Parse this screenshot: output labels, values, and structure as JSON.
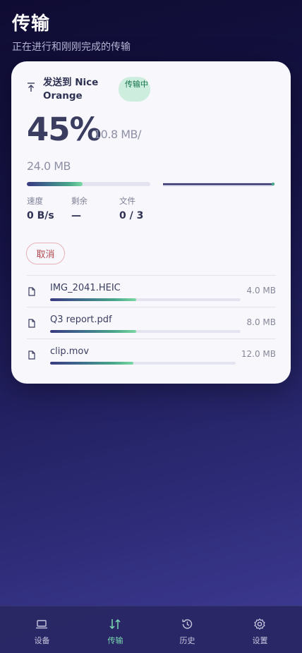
{
  "header": {
    "title": "传输",
    "subtitle": "正在进行和刚刚完成的传输"
  },
  "transfer": {
    "title": "发送到 Nice Orange",
    "status": "传输中",
    "percent_label": "45%",
    "progress": 0.45,
    "current_size": "10.8 MB/",
    "total_size": "24.0 MB",
    "stats": [
      {
        "label": "速度",
        "value": "0 B/s"
      },
      {
        "label": "剩余",
        "value": "—"
      },
      {
        "label": "文件",
        "value": "0 / 3"
      }
    ],
    "cancel_label": "取消",
    "files": [
      {
        "name": "IMG_2041.HEIC",
        "size": "4.0 MB",
        "progress": 0.45
      },
      {
        "name": "Q3 report.pdf",
        "size": "8.0 MB",
        "progress": 0.45
      },
      {
        "name": "clip.mov",
        "size": "12.0 MB",
        "progress": 0.45
      }
    ]
  },
  "tabbar": {
    "items": [
      {
        "label": "设备",
        "icon": "laptop-icon"
      },
      {
        "label": "传输",
        "icon": "transfer-arrows-icon",
        "active": true
      },
      {
        "label": "历史",
        "icon": "history-icon"
      },
      {
        "label": "设置",
        "icon": "settings-icon"
      }
    ]
  },
  "colors": {
    "accent": "#7ad8b0",
    "status_bg": "#cdeede",
    "cancel": "#b0484f"
  }
}
